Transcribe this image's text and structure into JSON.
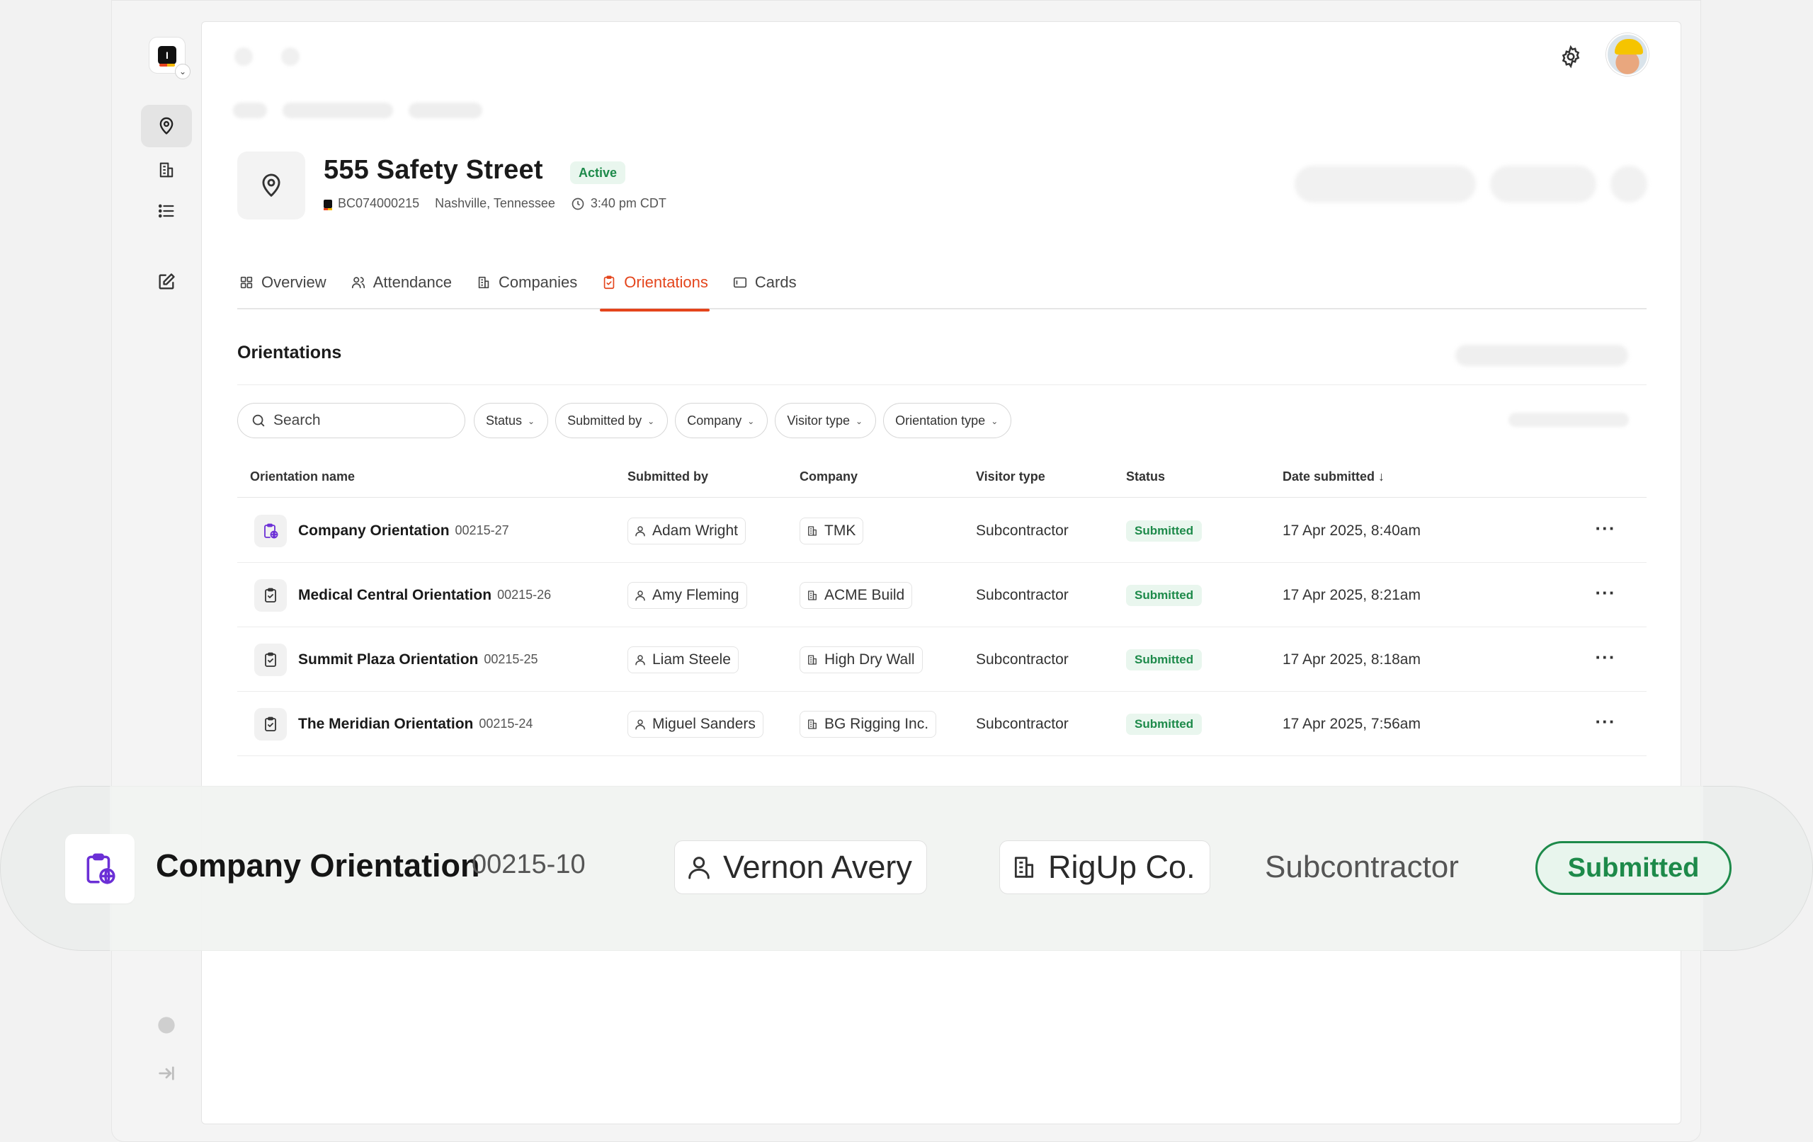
{
  "rail": {
    "logo_letter": "I",
    "items": [
      {
        "name": "location-pin-icon",
        "active": true
      },
      {
        "name": "building-icon",
        "active": false
      },
      {
        "name": "list-icon",
        "active": false
      },
      {
        "name": "edit-icon",
        "active": false
      }
    ]
  },
  "site": {
    "title": "555 Safety Street",
    "status": "Active",
    "code": "BC074000215",
    "location": "Nashville, Tennessee",
    "time": "3:40 pm CDT"
  },
  "tabs": [
    {
      "label": "Overview",
      "icon": "grid-icon",
      "active": false
    },
    {
      "label": "Attendance",
      "icon": "users-icon",
      "active": false
    },
    {
      "label": "Companies",
      "icon": "building-icon",
      "active": false
    },
    {
      "label": "Orientations",
      "icon": "clipboard-check-icon",
      "active": true
    },
    {
      "label": "Cards",
      "icon": "card-icon",
      "active": false
    }
  ],
  "section": {
    "title": "Orientations"
  },
  "search": {
    "placeholder": "Search"
  },
  "filters": [
    "Status",
    "Submitted by",
    "Company",
    "Visitor type",
    "Orientation type"
  ],
  "table": {
    "headers": {
      "name": "Orientation name",
      "submitted_by": "Submitted by",
      "company": "Company",
      "visitor_type": "Visitor type",
      "status": "Status",
      "date": "Date submitted ↓"
    },
    "rows": [
      {
        "icon": "clipboard-globe-icon",
        "name": "Company Orientation",
        "num": "00215-27",
        "submitted_by": "Adam Wright",
        "company": "TMK",
        "visitor_type": "Subcontractor",
        "status": "Submitted",
        "date": "17 Apr 2025, 8:40am"
      },
      {
        "icon": "clipboard-check-icon",
        "name": "Medical Central Orientation",
        "num": "00215-26",
        "submitted_by": "Amy Fleming",
        "company": "ACME Build",
        "visitor_type": "Subcontractor",
        "status": "Submitted",
        "date": "17 Apr 2025, 8:21am"
      },
      {
        "icon": "clipboard-check-icon",
        "name": "Summit Plaza Orientation",
        "num": "00215-25",
        "submitted_by": "Liam Steele",
        "company": "High Dry Wall",
        "visitor_type": "Subcontractor",
        "status": "Submitted",
        "date": "17 Apr 2025, 8:18am"
      },
      {
        "icon": "clipboard-check-icon",
        "name": "The Meridian Orientation",
        "num": "00215-24",
        "submitted_by": "Miguel Sanders",
        "company": "BG Rigging Inc.",
        "visitor_type": "Subcontractor",
        "status": "Submitted",
        "date": "17 Apr 2025, 7:56am"
      }
    ]
  },
  "highlight": {
    "icon": "clipboard-globe-icon",
    "name": "Company Orientation",
    "num": "00215-10",
    "submitted_by": "Vernon Avery",
    "company": "RigUp Co.",
    "visitor_type": "Subcontractor",
    "status": "Submitted"
  },
  "colors": {
    "accent": "#e4451c",
    "success": "#1d8a4a",
    "success_bg": "#e9f6ee",
    "purple_icon": "#6b2fd6"
  }
}
